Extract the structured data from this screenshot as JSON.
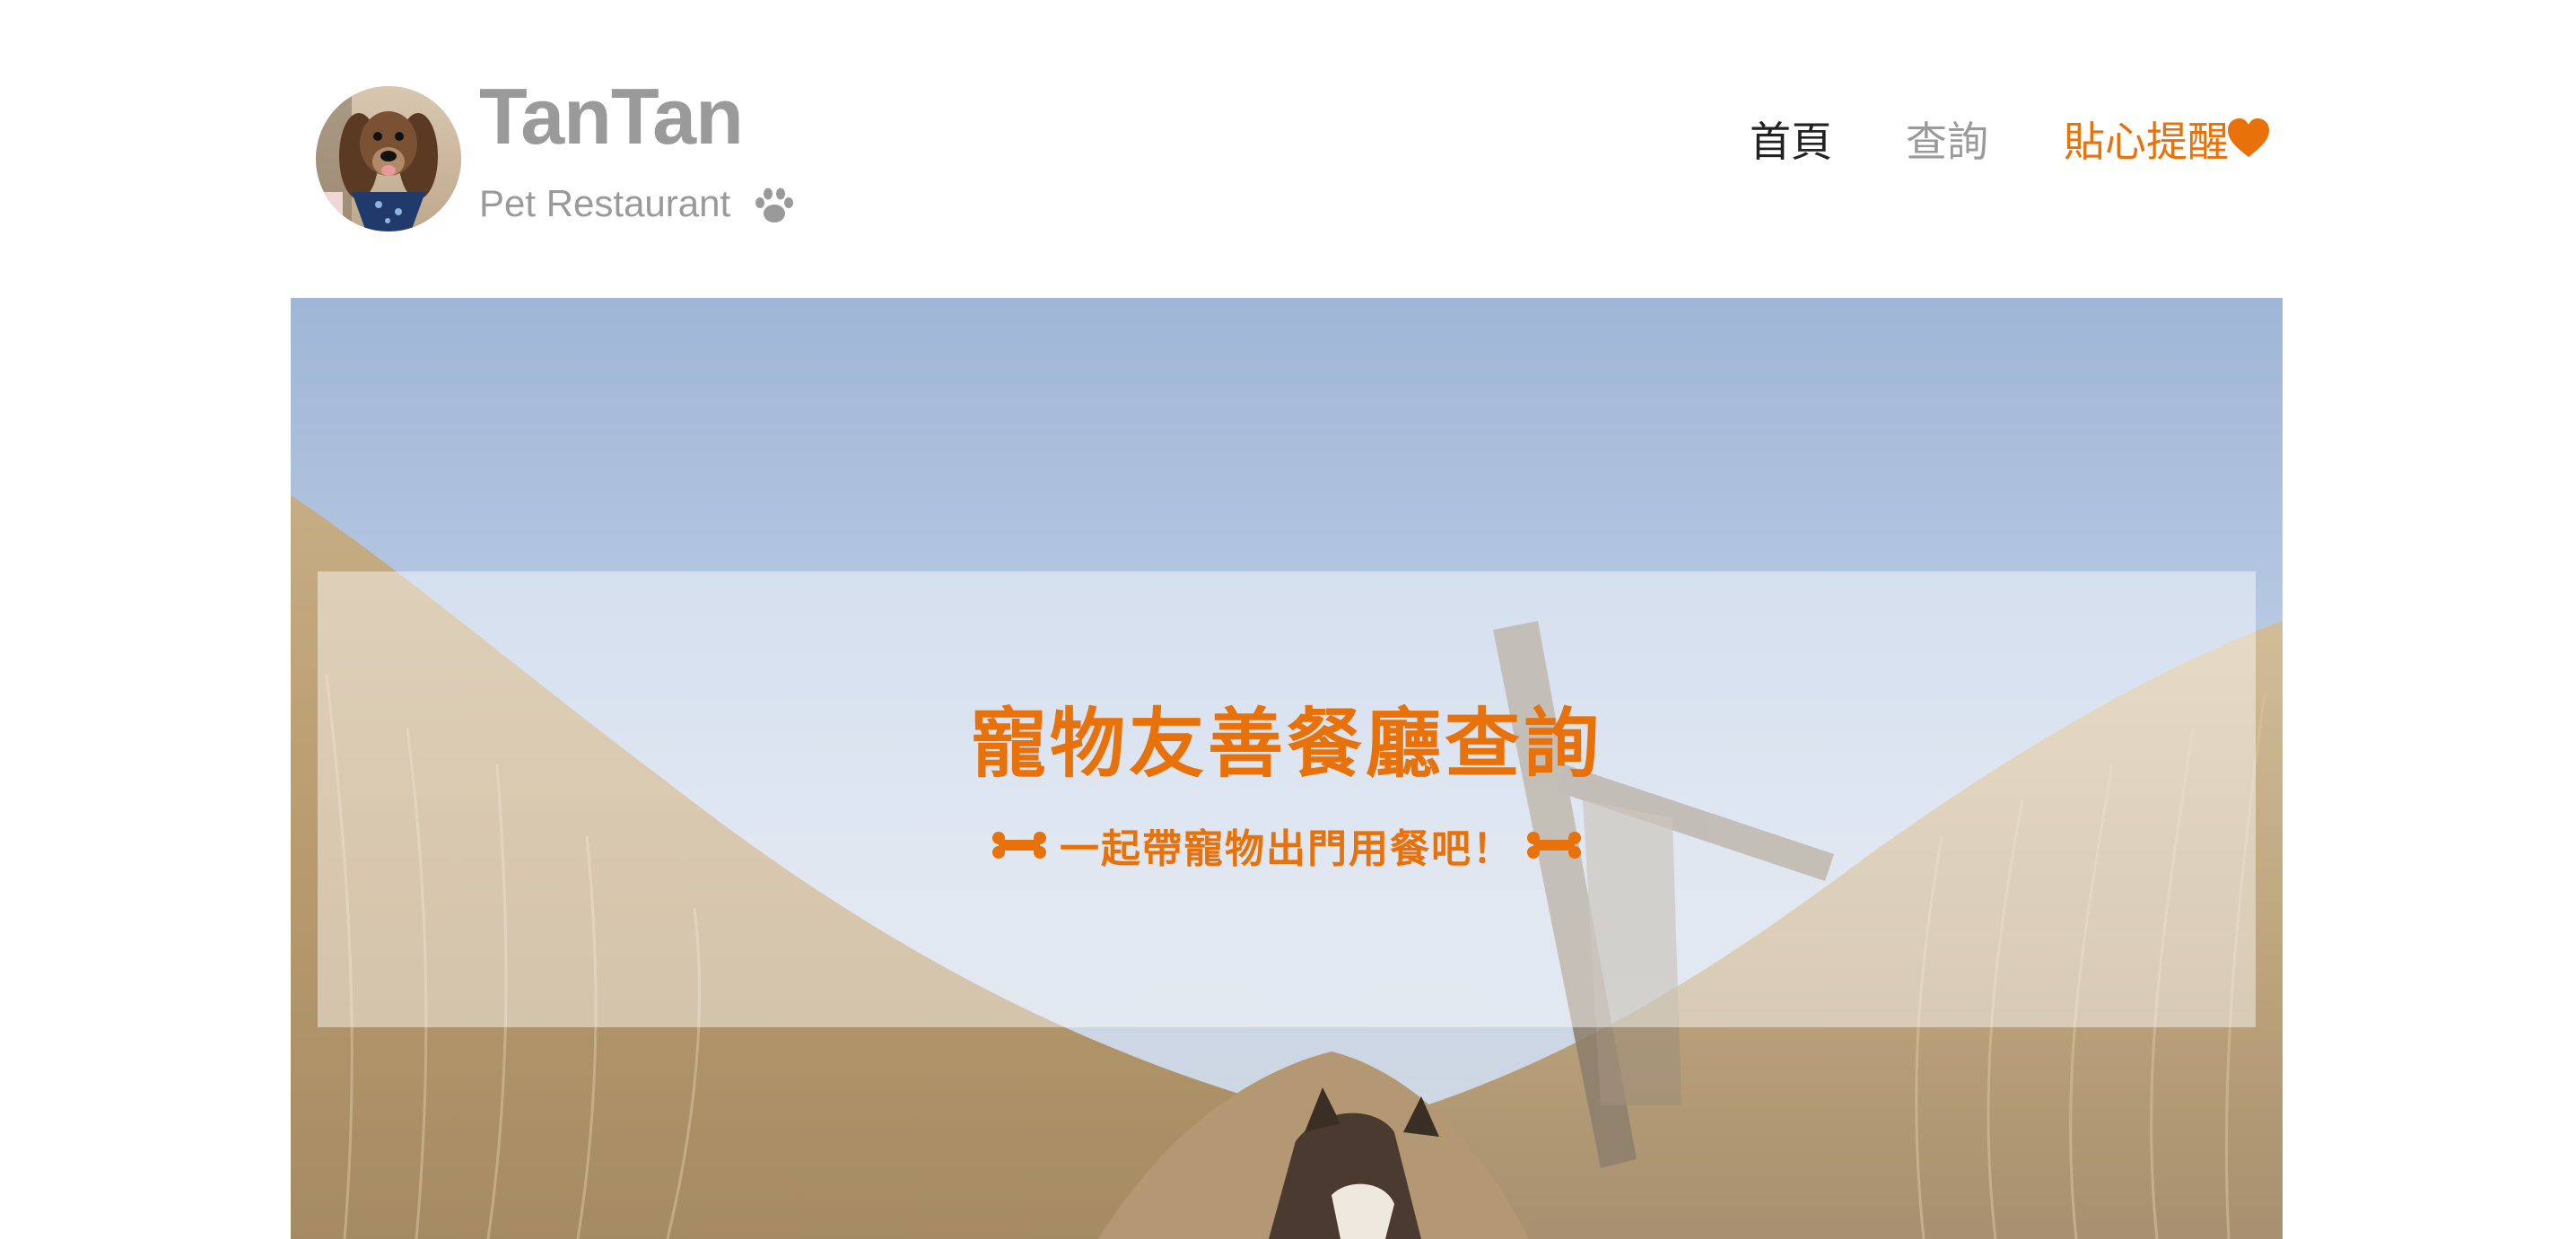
{
  "header": {
    "brand_title": "TanTan",
    "brand_subtitle": "Pet Restaurant",
    "avatar_icon": "dog-avatar",
    "paw_icon": "paw-icon"
  },
  "nav": {
    "items": [
      {
        "label": "首頁",
        "state": "active"
      },
      {
        "label": "查詢",
        "state": "normal"
      },
      {
        "label": "貼心提醒",
        "state": "highlight"
      }
    ],
    "heart_icon": "heart-icon"
  },
  "hero": {
    "title": "寵物友善餐廳查詢",
    "subtitle": "一起帶寵物出門用餐吧！",
    "bone_icon": "bone-icon",
    "background": "dog-in-dune-grass-photo"
  },
  "colors": {
    "accent": "#e8710a",
    "muted_text": "#9a9a9a",
    "dark_text": "#222222",
    "sky": "#a9bfdc",
    "grass": "#c9ad82"
  }
}
